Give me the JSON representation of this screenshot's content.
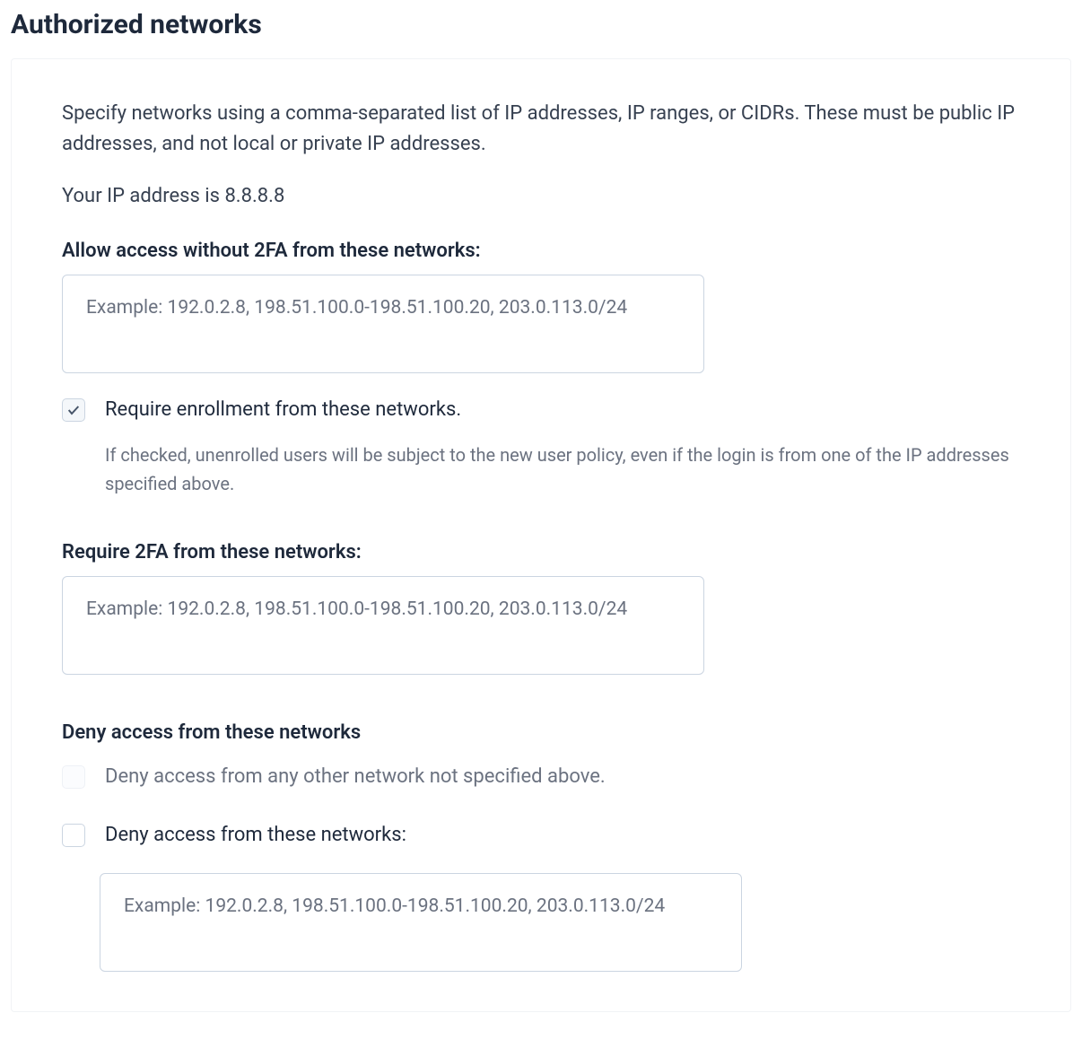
{
  "section_title": "Authorized networks",
  "intro_text": "Specify networks using a comma-separated list of IP addresses, IP ranges, or CIDRs. These must be public IP addresses, and not local or private IP addresses.",
  "your_ip_text": "Your IP address is 8.8.8.8",
  "allow": {
    "label": "Allow access without 2FA from these networks:",
    "placeholder": "Example: 192.0.2.8, 198.51.100.0-198.51.100.20, 203.0.113.0/24",
    "require_enrollment_label": "Require enrollment from these networks.",
    "require_enrollment_help": "If checked, unenrolled users will be subject to the new user policy, even if the login is from one of the IP addresses specified above."
  },
  "require": {
    "label": "Require 2FA from these networks:",
    "placeholder": "Example: 192.0.2.8, 198.51.100.0-198.51.100.20, 203.0.113.0/24"
  },
  "deny": {
    "heading": "Deny access from these networks",
    "deny_other_label": "Deny access from any other network not specified above.",
    "deny_these_label": "Deny access from these networks:",
    "placeholder": "Example: 192.0.2.8, 198.51.100.0-198.51.100.20, 203.0.113.0/24"
  }
}
